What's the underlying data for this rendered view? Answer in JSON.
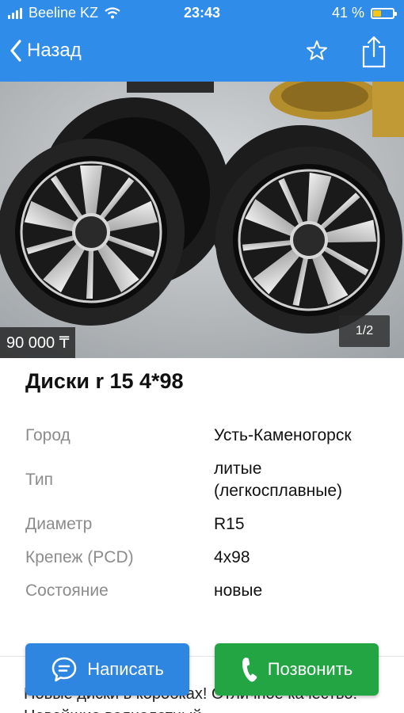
{
  "status_bar": {
    "carrier": "Beeline KZ",
    "time": "23:43",
    "battery": "41 %",
    "battery_level": 0.41
  },
  "nav": {
    "back_label": "Назад",
    "icons": [
      "chevron-left-icon",
      "star-icon",
      "share-icon"
    ]
  },
  "gallery": {
    "price": "90 000 ₸",
    "counter": "1/2"
  },
  "listing": {
    "title": "Диски r 15 4*98",
    "specs": [
      {
        "label": "Город",
        "value": "Усть-Каменогорск"
      },
      {
        "label": "Тип",
        "value": "литые (легкосплавные)"
      },
      {
        "label": "Диаметр",
        "value": "R15"
      },
      {
        "label": "Крепеж (PCD)",
        "value": "4x98"
      },
      {
        "label": "Состояние",
        "value": "новые"
      }
    ],
    "description": "Новые диски в коробках! Отличное качество! Новейшие волнолетный"
  },
  "actions": {
    "write_label": "Написать",
    "call_label": "Позвонить"
  },
  "colors": {
    "header": "#2f8ce8",
    "write_button": "#2f86e0",
    "call_button": "#23a544"
  }
}
